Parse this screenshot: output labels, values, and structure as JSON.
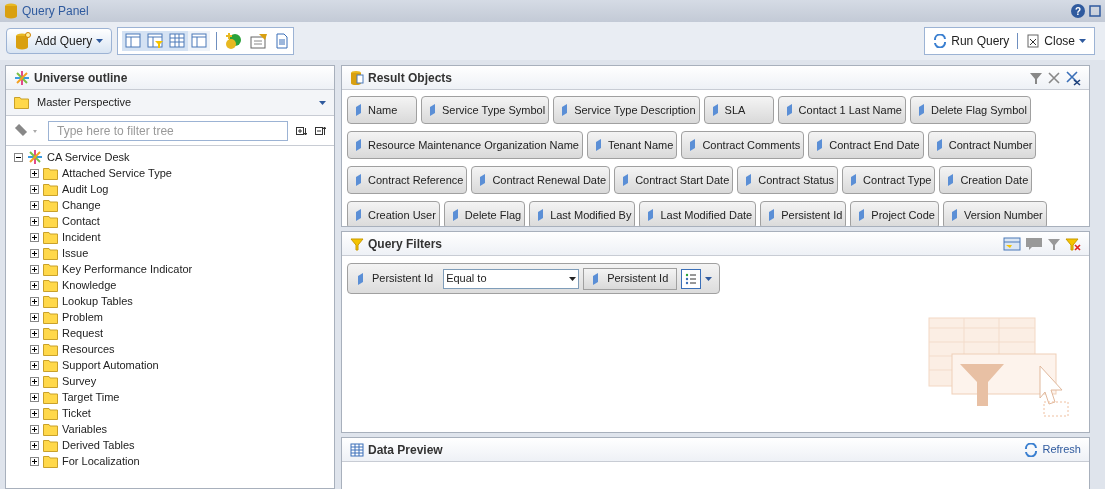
{
  "window": {
    "title": "Query Panel",
    "help": "?"
  },
  "toolbar": {
    "add_query": "Add Query",
    "run_query": "Run Query",
    "close": "Close"
  },
  "universe_outline": {
    "title": "Universe outline",
    "perspective": "Master Perspective",
    "filter": {
      "placeholder": "Type here to filter tree"
    },
    "tree": [
      {
        "label": "CA Service Desk",
        "expanded": true,
        "children": [
          {
            "label": "Attached Service Type",
            "expanded": false
          },
          {
            "label": "Audit Log",
            "expanded": false
          },
          {
            "label": "Change",
            "expanded": false
          },
          {
            "label": "Contact",
            "expanded": false
          },
          {
            "label": "Incident",
            "expanded": false
          },
          {
            "label": "Issue",
            "expanded": false
          },
          {
            "label": "Key Performance Indicator",
            "expanded": false
          },
          {
            "label": "Knowledge",
            "expanded": false
          },
          {
            "label": "Lookup Tables",
            "expanded": false
          },
          {
            "label": "Problem",
            "expanded": false
          },
          {
            "label": "Request",
            "expanded": false
          },
          {
            "label": "Resources",
            "expanded": false
          },
          {
            "label": "Support Automation",
            "expanded": false
          },
          {
            "label": "Survey",
            "expanded": false
          },
          {
            "label": "Target Time",
            "expanded": false
          },
          {
            "label": "Ticket",
            "expanded": false
          },
          {
            "label": "Variables",
            "expanded": false
          },
          {
            "label": "Derived Tables",
            "expanded": false
          },
          {
            "label": "For Localization",
            "expanded": false
          }
        ]
      }
    ]
  },
  "result_objects": {
    "title": "Result Objects",
    "objects": [
      "Name",
      "Service Type Symbol",
      "Service Type Description",
      "SLA",
      "Contact 1 Last Name",
      "Delete Flag Symbol",
      "Resource Maintenance Organization Name",
      "Tenant Name",
      "Contract Comments",
      "Contract End Date",
      "Contract Number",
      "Contract Reference",
      "Contract Renewal Date",
      "Contract Start Date",
      "Contract Status",
      "Contract Type",
      "Creation Date",
      "Creation User",
      "Delete Flag",
      "Last Modified By",
      "Last Modified Date",
      "Persistent Id",
      "Project Code",
      "Version Number"
    ]
  },
  "query_filters": {
    "title": "Query Filters",
    "filter": {
      "object": "Persistent Id",
      "operator": "Equal to",
      "operand": "Persistent Id"
    }
  },
  "data_preview": {
    "title": "Data Preview",
    "refresh": "Refresh"
  }
}
